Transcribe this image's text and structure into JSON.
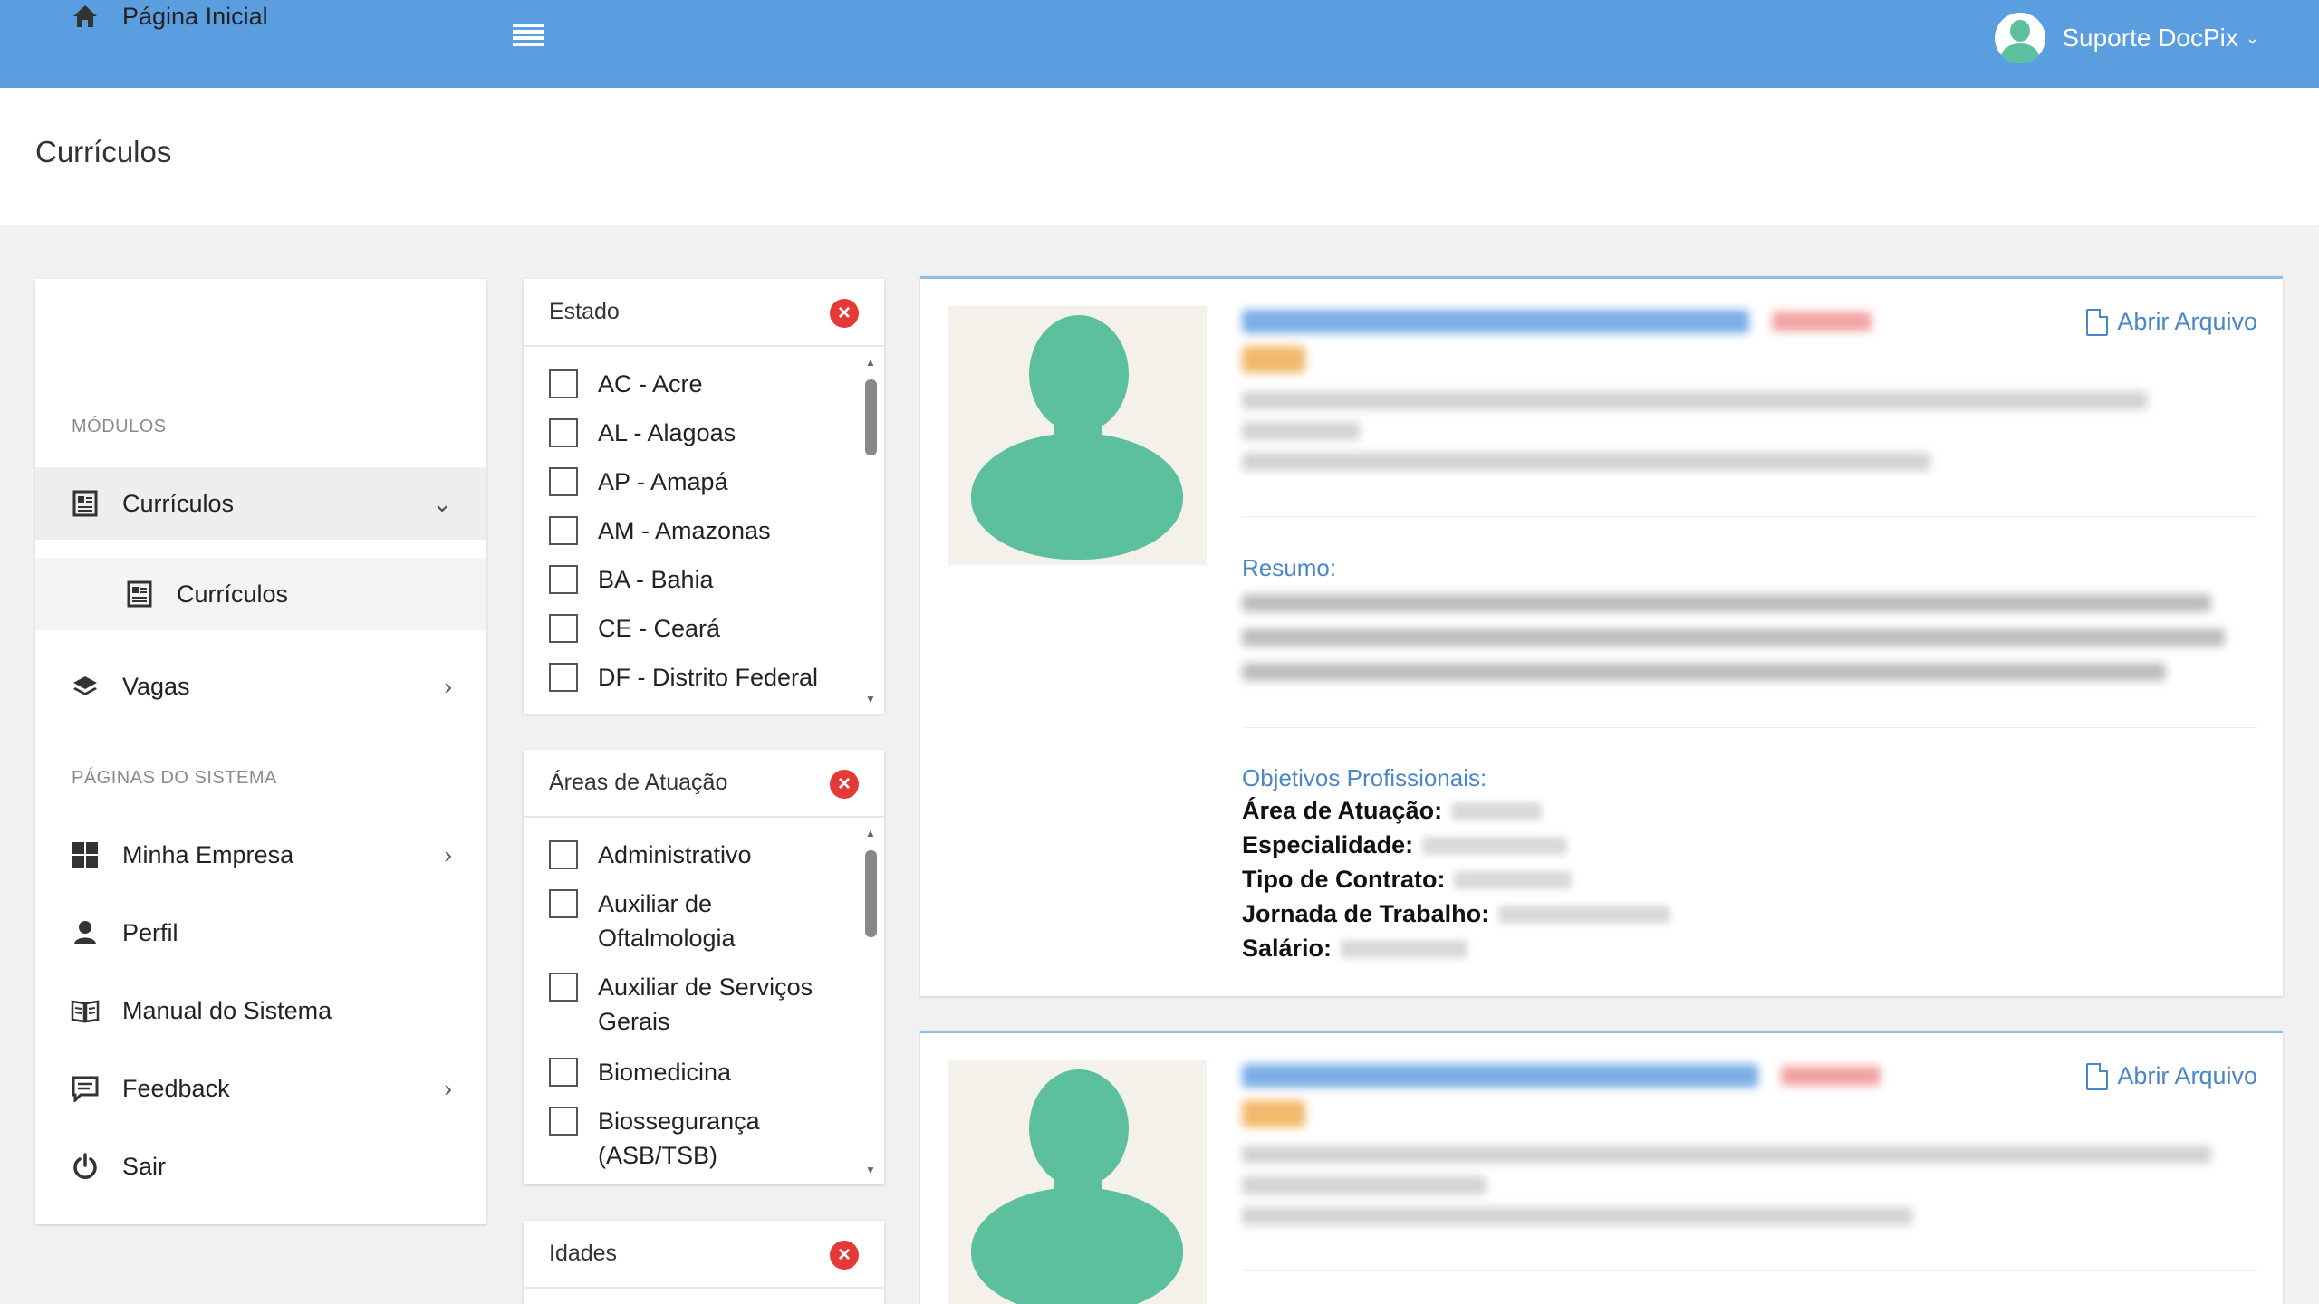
{
  "topbar": {
    "user_name": "Suporte DocPix"
  },
  "page": {
    "title": "Currículos"
  },
  "sidebar": {
    "home": "Página Inicial",
    "modules_label": "MÓDULOS",
    "curriculos": "Currículos",
    "curriculos_sub": "Currículos",
    "vagas": "Vagas",
    "system_pages_label": "PÁGINAS DO SISTEMA",
    "minha_empresa": "Minha Empresa",
    "perfil": "Perfil",
    "manual": "Manual do Sistema",
    "feedback": "Feedback",
    "sair": "Sair"
  },
  "filters": {
    "estado": {
      "title": "Estado",
      "items": [
        "AC - Acre",
        "AL - Alagoas",
        "AP - Amapá",
        "AM - Amazonas",
        "BA - Bahia",
        "CE - Ceará",
        "DF - Distrito Federal"
      ]
    },
    "areas": {
      "title": "Áreas de Atuação",
      "items": [
        "Administrativo",
        "Auxiliar de Oftalmologia",
        "Auxiliar de Serviços Gerais",
        "Biomedicina",
        "Biossegurança (ASB/TSB)"
      ]
    },
    "idades": {
      "title": "Idades"
    }
  },
  "cards": [
    {
      "open_file": "Abrir Arquivo",
      "resumo_label": "Resumo:",
      "objetivos_label": "Objetivos Profissionais:",
      "fields": [
        "Área de Atuação:",
        "Especialidade:",
        "Tipo de Contrato:",
        "Jornada de Trabalho:",
        "Salário:"
      ]
    },
    {
      "open_file": "Abrir Arquivo"
    }
  ],
  "colors": {
    "topbar": "#5b9ee0",
    "accent": "#4a86c8",
    "avatar": "#5cbf9d",
    "close": "#e53935"
  }
}
